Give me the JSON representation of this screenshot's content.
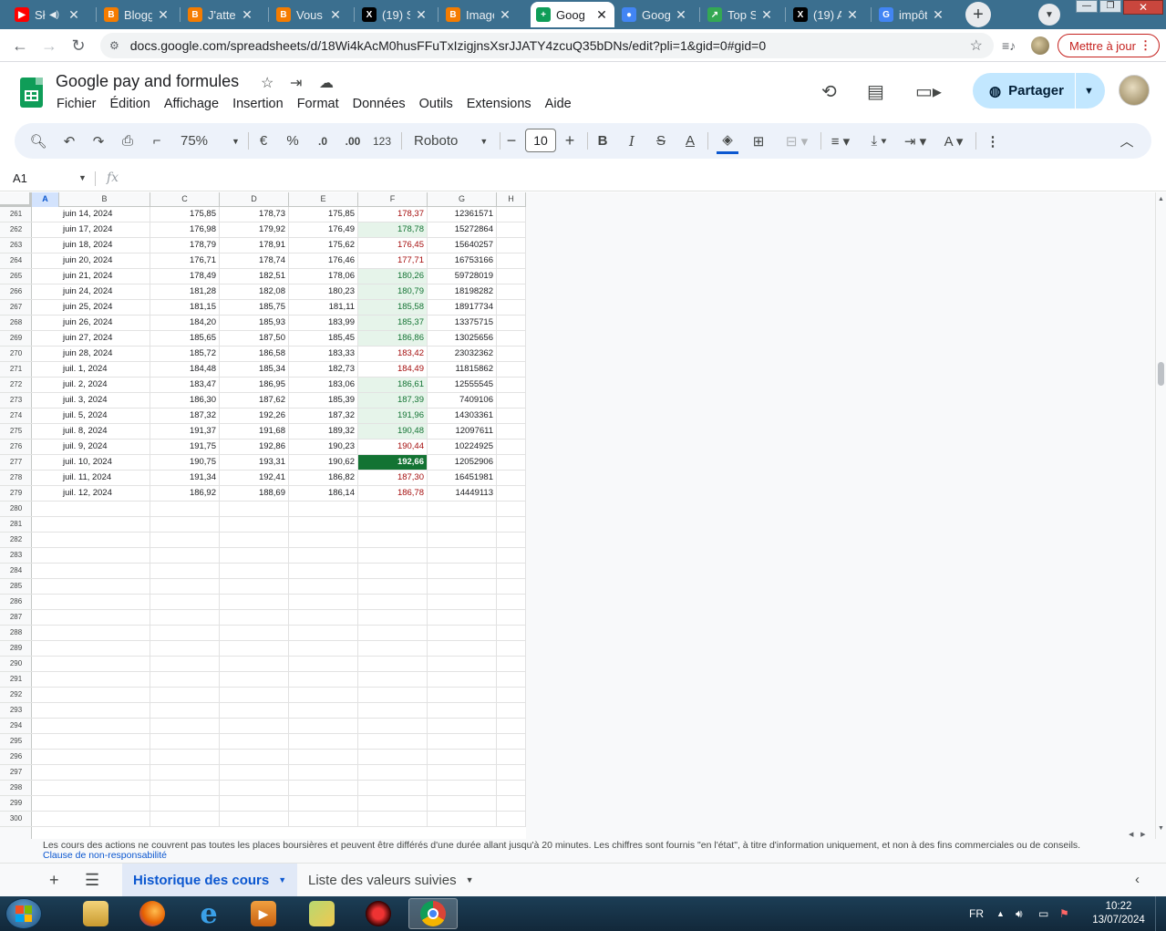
{
  "browser": {
    "tabs": [
      {
        "title": "Sł",
        "icon": "youtube-icon",
        "color": "#ff0000",
        "glyph": "▶",
        "audio": true
      },
      {
        "title": "Blogg",
        "icon": "blogger-icon",
        "color": "#f57c00",
        "glyph": "B"
      },
      {
        "title": "J'atte",
        "icon": "blogger-icon",
        "color": "#f57c00",
        "glyph": "B"
      },
      {
        "title": "Vous",
        "icon": "blogger-icon",
        "color": "#f57c00",
        "glyph": "B"
      },
      {
        "title": "(19) S",
        "icon": "x-icon",
        "color": "#000000",
        "glyph": "X"
      },
      {
        "title": "Image",
        "icon": "blogger-icon",
        "color": "#f57c00",
        "glyph": "B"
      },
      {
        "title": "Goog",
        "icon": "sheets-icon",
        "color": "#0f9d58",
        "glyph": "+",
        "active": true
      },
      {
        "title": "Goog",
        "icon": "gemini-icon",
        "color": "#4285f4",
        "glyph": "●"
      },
      {
        "title": "Top S",
        "icon": "chart-icon",
        "color": "#34a853",
        "glyph": "↗"
      },
      {
        "title": "(19) A",
        "icon": "x-icon",
        "color": "#000000",
        "glyph": "X"
      },
      {
        "title": "impôt",
        "icon": "google-icon",
        "color": "#4285f4",
        "glyph": "G"
      }
    ],
    "url": "docs.google.com/spreadsheets/d/18Wi4kAcM0husFFuTxIzigjnsXsrJJATY4zcuQ35bDNs/edit?pli=1&gid=0#gid=0",
    "update_label": "Mettre à jour"
  },
  "doc": {
    "title": "Google pay and formules",
    "menu": [
      "Fichier",
      "Édition",
      "Affichage",
      "Insertion",
      "Format",
      "Données",
      "Outils",
      "Extensions",
      "Aide"
    ],
    "share_label": "Partager"
  },
  "toolbar": {
    "zoom": "75%",
    "currency": "€",
    "percent": "%",
    "decimal_decrease": ".0",
    "decimal_increase": ".00",
    "number_format": "123",
    "font": "Roboto",
    "font_size": "10"
  },
  "formula_bar": {
    "name_box": "A1",
    "fx": "fx"
  },
  "grid": {
    "columns": [
      "A",
      "B",
      "C",
      "D",
      "E",
      "F",
      "G",
      "H"
    ],
    "selected_column": "A",
    "rows": [
      {
        "n": "261",
        "date": "juin 14, 2024",
        "c": "175,85",
        "d": "178,73",
        "e": "175,85",
        "f": "178,37",
        "g": "12361571",
        "f_state": "down"
      },
      {
        "n": "262",
        "date": "juin 17, 2024",
        "c": "176,98",
        "d": "179,92",
        "e": "176,49",
        "f": "178,78",
        "g": "15272864",
        "f_state": "up"
      },
      {
        "n": "263",
        "date": "juin 18, 2024",
        "c": "178,79",
        "d": "178,91",
        "e": "175,62",
        "f": "176,45",
        "g": "15640257",
        "f_state": "down"
      },
      {
        "n": "264",
        "date": "juin 20, 2024",
        "c": "176,71",
        "d": "178,74",
        "e": "176,46",
        "f": "177,71",
        "g": "16753166",
        "f_state": "down"
      },
      {
        "n": "265",
        "date": "juin 21, 2024",
        "c": "178,49",
        "d": "182,51",
        "e": "178,06",
        "f": "180,26",
        "g": "59728019",
        "f_state": "up"
      },
      {
        "n": "266",
        "date": "juin 24, 2024",
        "c": "181,28",
        "d": "182,08",
        "e": "180,23",
        "f": "180,79",
        "g": "18198282",
        "f_state": "up"
      },
      {
        "n": "267",
        "date": "juin 25, 2024",
        "c": "181,15",
        "d": "185,75",
        "e": "181,11",
        "f": "185,58",
        "g": "18917734",
        "f_state": "up"
      },
      {
        "n": "268",
        "date": "juin 26, 2024",
        "c": "184,20",
        "d": "185,93",
        "e": "183,99",
        "f": "185,37",
        "g": "13375715",
        "f_state": "up"
      },
      {
        "n": "269",
        "date": "juin 27, 2024",
        "c": "185,65",
        "d": "187,50",
        "e": "185,45",
        "f": "186,86",
        "g": "13025656",
        "f_state": "up"
      },
      {
        "n": "270",
        "date": "juin 28, 2024",
        "c": "185,72",
        "d": "186,58",
        "e": "183,33",
        "f": "183,42",
        "g": "23032362",
        "f_state": "down"
      },
      {
        "n": "271",
        "date": "juil. 1, 2024",
        "c": "184,48",
        "d": "185,34",
        "e": "182,73",
        "f": "184,49",
        "g": "11815862",
        "f_state": "down"
      },
      {
        "n": "272",
        "date": "juil. 2, 2024",
        "c": "183,47",
        "d": "186,95",
        "e": "183,06",
        "f": "186,61",
        "g": "12555545",
        "f_state": "up"
      },
      {
        "n": "273",
        "date": "juil. 3, 2024",
        "c": "186,30",
        "d": "187,62",
        "e": "185,39",
        "f": "187,39",
        "g": "7409106",
        "f_state": "up"
      },
      {
        "n": "274",
        "date": "juil. 5, 2024",
        "c": "187,32",
        "d": "192,26",
        "e": "187,32",
        "f": "191,96",
        "g": "14303361",
        "f_state": "up"
      },
      {
        "n": "275",
        "date": "juil. 8, 2024",
        "c": "191,37",
        "d": "191,68",
        "e": "189,32",
        "f": "190,48",
        "g": "12097611",
        "f_state": "up"
      },
      {
        "n": "276",
        "date": "juil. 9, 2024",
        "c": "191,75",
        "d": "192,86",
        "e": "190,23",
        "f": "190,44",
        "g": "10224925",
        "f_state": "down"
      },
      {
        "n": "277",
        "date": "juil. 10, 2024",
        "c": "190,75",
        "d": "193,31",
        "e": "190,62",
        "f": "192,66",
        "g": "12052906",
        "f_state": "max"
      },
      {
        "n": "278",
        "date": "juil. 11, 2024",
        "c": "191,34",
        "d": "192,41",
        "e": "186,82",
        "f": "187,30",
        "g": "16451981",
        "f_state": "down"
      },
      {
        "n": "279",
        "date": "juil. 12, 2024",
        "c": "186,92",
        "d": "188,69",
        "e": "186,14",
        "f": "186,78",
        "g": "14449113",
        "f_state": "down"
      }
    ],
    "empty_rows": [
      "280",
      "281",
      "282",
      "283",
      "284",
      "285",
      "286",
      "287",
      "288",
      "289",
      "290",
      "291",
      "292",
      "293",
      "294",
      "295",
      "296",
      "297",
      "298",
      "299",
      "300"
    ]
  },
  "footer": {
    "disclaimer": "Les cours des actions ne couvrent pas toutes les places boursières et peuvent être différés d'une durée allant jusqu'à 20 minutes. Les chiffres sont fournis \"en l'état\", à titre d'information uniquement, et non à des fins commerciales ou de conseils.",
    "disclaimer_link": "Clause de non-responsabilité",
    "sheets": [
      "Historique des cours",
      "Liste des valeurs suivies"
    ],
    "active_sheet": 0
  },
  "taskbar": {
    "apps": [
      "explorer-icon",
      "firefox-icon",
      "ie-icon",
      "media-player-icon",
      "folder-icon",
      "tool-icon",
      "chrome-icon"
    ],
    "lang": "FR",
    "time": "10:22",
    "date": "13/07/2024"
  },
  "colors": {
    "up_green": "#137333",
    "up_bg": "#e6f4ea",
    "down_red": "#a50e0e",
    "accent_blue": "#0b57d0",
    "share_bg": "#c2e7ff"
  }
}
